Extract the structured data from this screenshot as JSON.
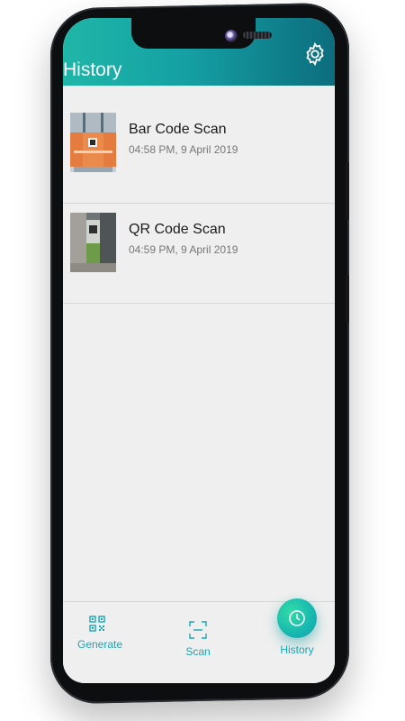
{
  "header": {
    "title": "History",
    "settings_icon": "gear-icon"
  },
  "history": [
    {
      "title": "Bar Code Scan",
      "time": "04:58 PM, 9 April 2019",
      "thumbnail": "barcode-photo"
    },
    {
      "title": "QR Code Scan",
      "time": "04:59 PM, 9 April 2019",
      "thumbnail": "qr-photo"
    }
  ],
  "nav": {
    "generate": {
      "label": "Generate",
      "icon": "qr-code-icon"
    },
    "scan": {
      "label": "Scan",
      "icon": "scan-frame-icon"
    },
    "history": {
      "label": "History",
      "icon": "clock-icon"
    }
  },
  "colors": {
    "accent": "#16a7b6",
    "header_start": "#1fb6a8",
    "header_end": "#0c6d7d"
  }
}
